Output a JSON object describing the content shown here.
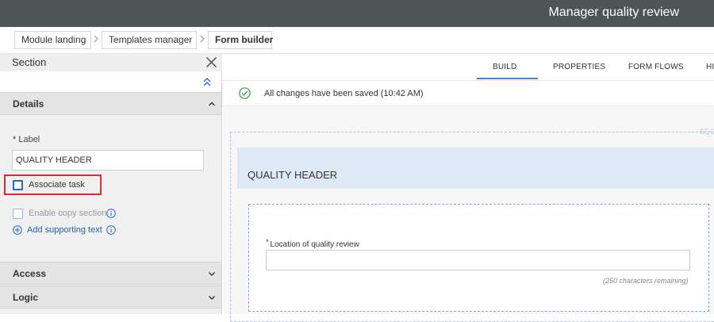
{
  "header": {
    "title": "Manager quality review"
  },
  "breadcrumb": [
    "Module landing",
    "Templates manager",
    "Form builder"
  ],
  "panel": {
    "title": "Section",
    "sections": {
      "details": "Details",
      "access": "Access",
      "logic": "Logic"
    },
    "label_field": {
      "label": "* Label",
      "value": "QUALITY HEADER"
    },
    "associate_task": "Associate task",
    "enable_copy": "Enable copy section",
    "add_supporting": "Add supporting text"
  },
  "tabs": [
    "BUILD",
    "PROPERTIES",
    "FORM FLOWS",
    "HI"
  ],
  "save_status": "All changes have been saved (10:42 AM)",
  "canvas": {
    "section_tag": "SEC",
    "section_title": "QUALITY HEADER",
    "field_required_mark": "*",
    "field_label": "Location of quality review",
    "chars_remaining": "(250 characters remaining)"
  },
  "colors": {
    "header_bg": "#4e5556",
    "accent": "#4a87c8",
    "highlight": "#e02a36",
    "link": "#1e61b4"
  }
}
